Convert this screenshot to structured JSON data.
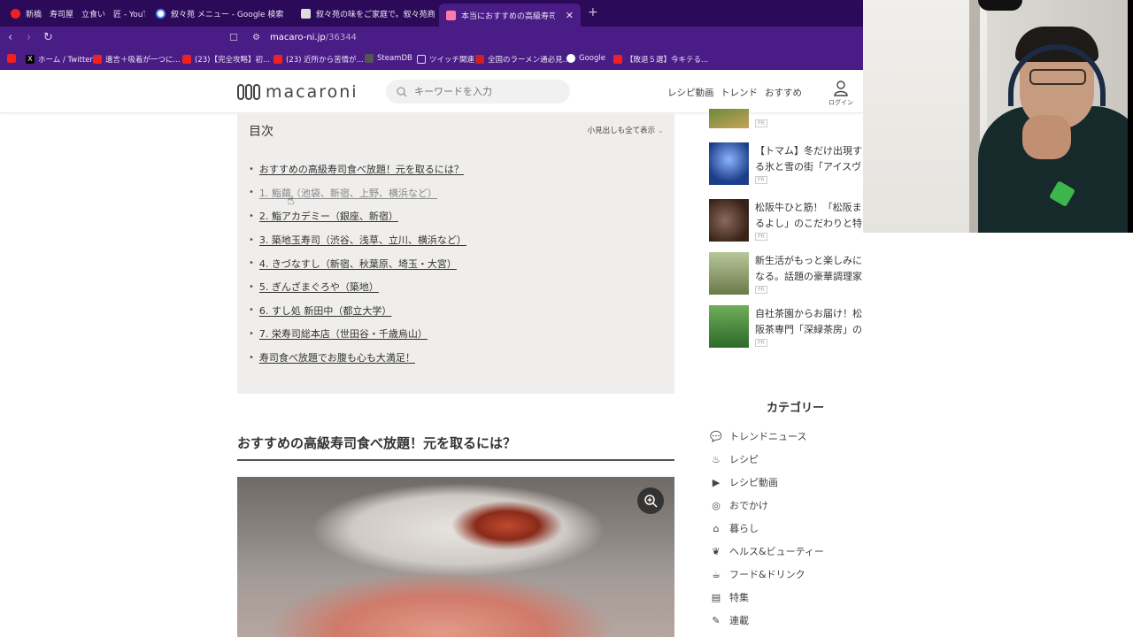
{
  "browser": {
    "tabs": [
      {
        "label": "新橋　寿司屋　立食い　匠 - YouTube",
        "fav": "#e22"
      },
      {
        "label": "叙々苑 メニュー - Google 検索",
        "fav": "#fff"
      },
      {
        "label": "叙々苑の味をご家庭で。叙々苑商品総",
        "fav": "#ddd"
      },
      {
        "label": "本当におすすめの高級寿司食べ放題",
        "fav": "#ff7aa8"
      }
    ],
    "new_tab": "+",
    "url_host": "macaro-ni.jp",
    "url_path": "/36344",
    "bookmarks": [
      {
        "label": "",
        "color": "#e22"
      },
      {
        "label": "ホーム / Twitter",
        "color": "#000"
      },
      {
        "label": "遺言＋吸着が一つに...",
        "color": "#e22"
      },
      {
        "label": "(23)【完全攻略】初...",
        "color": "#e22"
      },
      {
        "label": "(23) 近所から苦情が...",
        "color": "#e22"
      },
      {
        "label": "SteamDB",
        "color": "#555"
      },
      {
        "label": "ツイッチ関連",
        "color": "#ddd"
      },
      {
        "label": "全国のラーメン通必見...",
        "color": "#c22"
      },
      {
        "label": "Google",
        "color": "#4a8af4"
      },
      {
        "label": "【敗退５選】今キテる...",
        "color": "#e22"
      }
    ]
  },
  "site": {
    "logo": "macaroni",
    "search_placeholder": "キーワードを入力",
    "nav": [
      "レシピ動画",
      "トレンド",
      "おすすめ"
    ],
    "login": "ログイン"
  },
  "toc": {
    "title": "目次",
    "toggle": "小見出しも全て表示",
    "items": [
      "おすすめの高級寿司食べ放題！元を取るには？",
      "1. 鮨繭（池袋、新宿、上野、横浜など）",
      "2. 鮨アカデミー（銀座、新宿）",
      "3. 築地玉寿司（渋谷、浅草、立川、横浜など）",
      "4. きづなすし（新宿、秋葉原、埼玉・大宮）",
      "5. ぎんざまぐろや（築地）",
      "6. すし処 新田中（都立大学）",
      "7. 栄寿司総本店（世田谷・千歳烏山）",
      "寿司食べ放題でお腹も心も大満足！"
    ]
  },
  "section_heading": "おすすめの高級寿司食べ放題！元を取るには？",
  "sidebar": {
    "recommended": [
      {
        "title": "",
        "pr": "PR",
        "thumb": "#7a8a3a"
      },
      {
        "title": "【トマム】冬だけ出現する氷と雪の街「アイスヴィレッジ」",
        "pr": "PR",
        "thumb": "#2a4fa0"
      },
      {
        "title": "松阪牛ひと筋！「松阪まるよし」のこだわりと特徴、人気",
        "pr": "PR",
        "thumb": "#5a3a2a"
      },
      {
        "title": "新生活がもっと楽しみになる。話題の豪華調理家電が当たる",
        "pr": "PR",
        "thumb": "#8a9a5a"
      },
      {
        "title": "自社茶園からお届け！松阪茶専門「深緑茶房」のこだわり",
        "pr": "PR",
        "thumb": "#4e8a3a"
      }
    ],
    "category_title": "カテゴリー",
    "categories": [
      {
        "label": "トレンドニュース",
        "icon": "chat-bubble-icon"
      },
      {
        "label": "レシピ",
        "icon": "chef-hat-icon"
      },
      {
        "label": "レシピ動画",
        "icon": "video-icon"
      },
      {
        "label": "おでかけ",
        "icon": "map-pin-icon"
      },
      {
        "label": "暮らし",
        "icon": "sofa-icon"
      },
      {
        "label": "ヘルス&ビューティー",
        "icon": "leaf-icon"
      },
      {
        "label": "フード&ドリンク",
        "icon": "cup-icon"
      },
      {
        "label": "特集",
        "icon": "book-icon"
      },
      {
        "label": "連載",
        "icon": "pen-icon"
      }
    ]
  }
}
